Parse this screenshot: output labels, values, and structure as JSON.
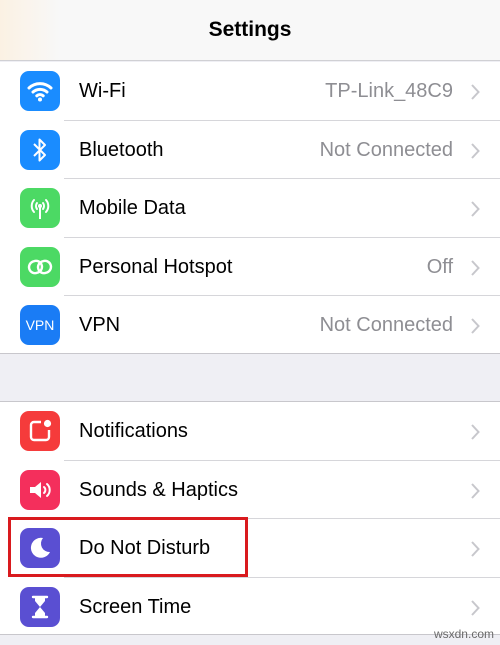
{
  "header": {
    "title": "Settings"
  },
  "group1": [
    {
      "name": "wifi",
      "icon": "wifi-icon",
      "color": "#1a8cff",
      "label": "Wi-Fi",
      "value": "TP-Link_48C9"
    },
    {
      "name": "bluetooth",
      "icon": "bluetooth-icon",
      "color": "#1a8cff",
      "label": "Bluetooth",
      "value": "Not Connected"
    },
    {
      "name": "mobile-data",
      "icon": "antenna-icon",
      "color": "#4cd964",
      "label": "Mobile Data",
      "value": ""
    },
    {
      "name": "personal-hotspot",
      "icon": "hotspot-chain-icon",
      "color": "#4cd964",
      "label": "Personal Hotspot",
      "value": "Off"
    },
    {
      "name": "vpn",
      "icon": "vpn-icon",
      "color": "#1a7cf5",
      "label": "VPN",
      "value": "Not Connected",
      "icon_text": "VPN"
    }
  ],
  "group2": [
    {
      "name": "notifications",
      "icon": "notifications-icon",
      "color": "#f53b3b",
      "label": "Notifications"
    },
    {
      "name": "sounds-haptics",
      "icon": "speaker-icon",
      "color": "#f42f5c",
      "label": "Sounds & Haptics"
    },
    {
      "name": "do-not-disturb",
      "icon": "moon-icon",
      "color": "#5a4fd2",
      "label": "Do Not Disturb"
    },
    {
      "name": "screen-time",
      "icon": "hourglass-icon",
      "color": "#5a4fd2",
      "label": "Screen Time"
    }
  ],
  "highlight_color": "#d91a1e",
  "watermark": "wsxdn.com"
}
